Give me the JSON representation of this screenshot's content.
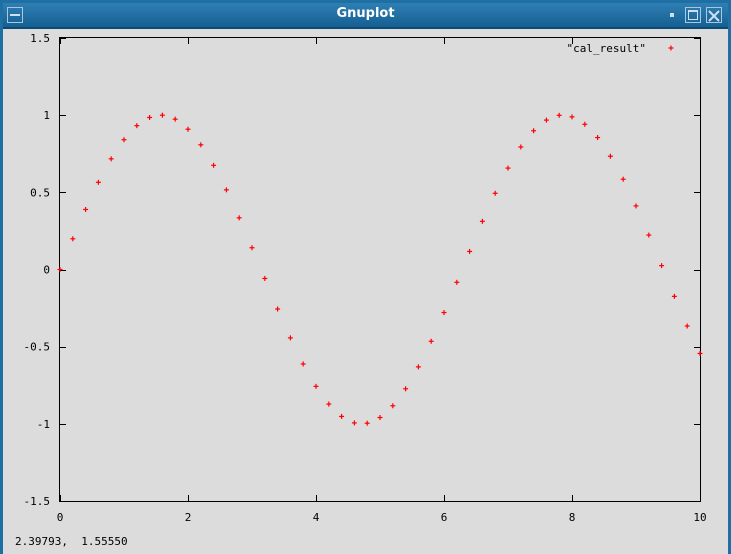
{
  "window": {
    "title": "Gnuplot",
    "status_coords": "2.39793,  1.55550"
  },
  "colors": {
    "background": "#dcdcdc",
    "series": "#ff0000",
    "titlebar": "#1e6fa3"
  },
  "icons": {
    "menu": "window-menu-icon",
    "minimize": "minimize-icon",
    "maximize": "maximize-icon",
    "close": "close-icon"
  },
  "chart_data": {
    "type": "scatter",
    "title": "",
    "xlabel": "",
    "ylabel": "",
    "xlim": [
      0,
      10
    ],
    "ylim": [
      -1.5,
      1.5
    ],
    "x_ticks": [
      {
        "value": 0,
        "label": "0"
      },
      {
        "value": 2,
        "label": "2"
      },
      {
        "value": 4,
        "label": "4"
      },
      {
        "value": 6,
        "label": "6"
      },
      {
        "value": 8,
        "label": "8"
      },
      {
        "value": 10,
        "label": "10"
      }
    ],
    "y_ticks": [
      {
        "value": -1.5,
        "label": "-1.5"
      },
      {
        "value": -1,
        "label": "-1"
      },
      {
        "value": -0.5,
        "label": "-0.5"
      },
      {
        "value": 0,
        "label": "0"
      },
      {
        "value": 0.5,
        "label": "0.5"
      },
      {
        "value": 1,
        "label": "1"
      },
      {
        "value": 1.5,
        "label": "1.5"
      }
    ],
    "grid": false,
    "legend": "top-right",
    "marker": "+",
    "series": [
      {
        "name": "\"cal_result\"",
        "color": "#ff0000",
        "x": [
          0,
          0.2,
          0.4,
          0.6,
          0.8,
          1,
          1.2,
          1.4,
          1.6,
          1.8,
          2,
          2.2,
          2.4,
          2.6,
          2.8,
          3,
          3.2,
          3.4,
          3.6,
          3.8,
          4,
          4.2,
          4.4,
          4.6,
          4.8,
          5,
          5.2,
          5.4,
          5.6,
          5.8,
          6,
          6.2,
          6.4,
          6.6,
          6.8,
          7,
          7.2,
          7.4,
          7.6,
          7.8,
          8,
          8.2,
          8.4,
          8.6,
          8.8,
          9,
          9.2,
          9.4,
          9.6,
          9.8,
          10
        ],
        "y": [
          0,
          0.199,
          0.389,
          0.565,
          0.717,
          0.841,
          0.932,
          0.985,
          1.0,
          0.974,
          0.909,
          0.808,
          0.675,
          0.516,
          0.335,
          0.141,
          -0.058,
          -0.256,
          -0.443,
          -0.612,
          -0.757,
          -0.872,
          -0.952,
          -0.994,
          -0.996,
          -0.959,
          -0.883,
          -0.773,
          -0.631,
          -0.465,
          -0.279,
          -0.083,
          0.117,
          0.312,
          0.494,
          0.657,
          0.794,
          0.899,
          0.968,
          0.999,
          0.989,
          0.941,
          0.855,
          0.734,
          0.585,
          0.412,
          0.223,
          0.025,
          -0.174,
          -0.366,
          -0.544
        ]
      }
    ]
  }
}
